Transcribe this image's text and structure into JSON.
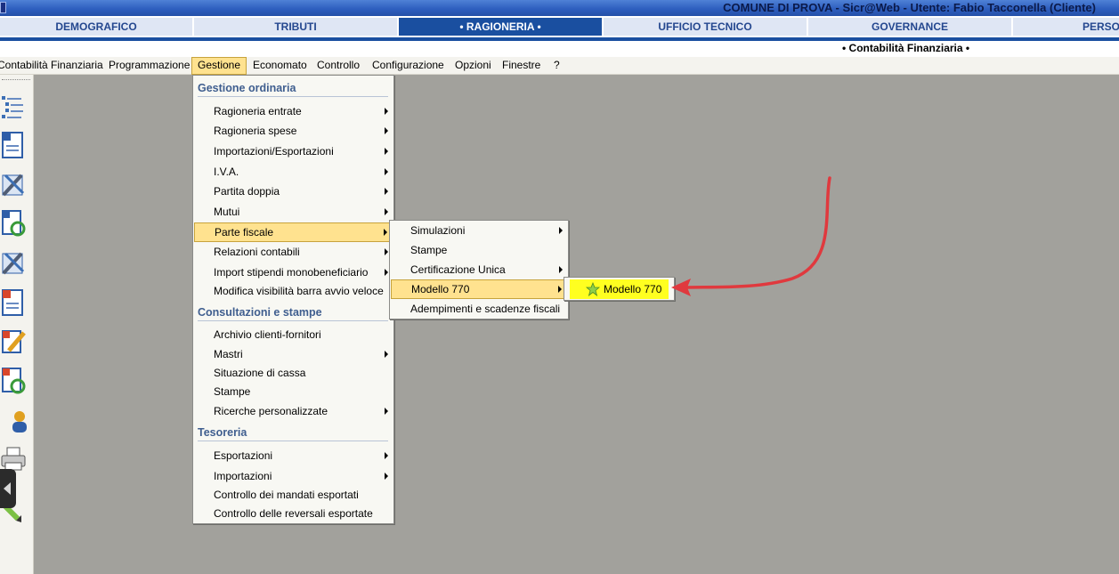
{
  "window": {
    "title": "COMUNE DI PROVA  -  Sicr@Web  -  Utente: Fabio Tacconella (Cliente)"
  },
  "modules": [
    {
      "label": "DEMOGRAFICO"
    },
    {
      "label": "TRIBUTI"
    },
    {
      "label": "• RAGIONERIA •"
    },
    {
      "label": "UFFICIO TECNICO"
    },
    {
      "label": "GOVERNANCE"
    },
    {
      "label": "PERSO"
    }
  ],
  "subheader": {
    "title": "• Contabilità Finanziaria •"
  },
  "menubar": [
    {
      "label": "Contabilità Finanziaria"
    },
    {
      "label": "Programmazione"
    },
    {
      "label": "Gestione"
    },
    {
      "label": "Economato"
    },
    {
      "label": "Controllo"
    },
    {
      "label": "Configurazione"
    },
    {
      "label": "Opzioni"
    },
    {
      "label": "Finestre"
    },
    {
      "label": "?"
    }
  ],
  "gestione_menu": {
    "sections": [
      {
        "title": "Gestione ordinaria"
      },
      {
        "title": "Consultazioni e stampe"
      },
      {
        "title": "Tesoreria"
      }
    ],
    "items": [
      {
        "label": "Ragioneria entrate"
      },
      {
        "label": "Ragioneria spese"
      },
      {
        "label": "Importazioni/Esportazioni"
      },
      {
        "label": "I.V.A."
      },
      {
        "label": "Partita doppia"
      },
      {
        "label": "Mutui"
      },
      {
        "label": "Parte fiscale"
      },
      {
        "label": "Relazioni contabili"
      },
      {
        "label": "Import stipendi monobeneficiario"
      },
      {
        "label": "Modifica visibilità barra avvio veloce"
      },
      {
        "label": "Archivio clienti-fornitori"
      },
      {
        "label": "Mastri"
      },
      {
        "label": "Situazione di cassa"
      },
      {
        "label": "Stampe"
      },
      {
        "label": "Ricerche personalizzate"
      },
      {
        "label": "Esportazioni"
      },
      {
        "label": "Importazioni"
      },
      {
        "label": "Controllo dei mandati esportati"
      },
      {
        "label": "Controllo delle reversali esportate"
      }
    ]
  },
  "parte_fiscale_menu": {
    "items": [
      {
        "label": "Simulazioni"
      },
      {
        "label": "Stampe"
      },
      {
        "label": "Certificazione Unica"
      },
      {
        "label": "Modello 770"
      },
      {
        "label": "Adempimenti e scadenze fiscali"
      }
    ]
  },
  "modello770_menu": {
    "item": {
      "label": "Modello 770",
      "icon": "star-icon"
    }
  },
  "colors": {
    "accent": "#1a4fa0",
    "highlight": "#ffe28f",
    "callout": "#ffff20",
    "arrow": "#e0393e",
    "workspace": "#a2a19c"
  }
}
